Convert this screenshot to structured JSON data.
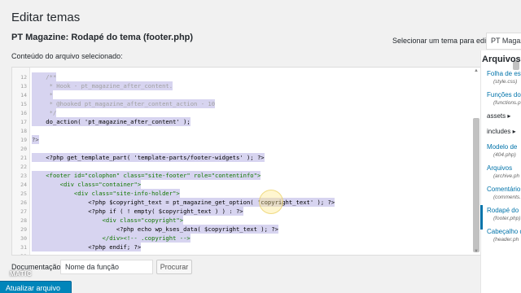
{
  "page": {
    "title": "Editar temas",
    "file_title": "PT Magazine: Rodapé do tema (footer.php)",
    "subhead": "Conteúdo do arquivo selecionado:"
  },
  "theme_selector": {
    "label": "Selecionar um tema para editar:",
    "value": "PT Magaz"
  },
  "editor": {
    "lines": [
      {
        "n": "12",
        "code": "    /**",
        "sel": true,
        "cls": "c-comment"
      },
      {
        "n": "13",
        "code": "     * Hook - pt_magazine_after_content.",
        "sel": true,
        "cls": "c-comment"
      },
      {
        "n": "14",
        "code": "     *",
        "sel": true,
        "cls": "c-comment"
      },
      {
        "n": "15",
        "code": "     * @hooked pt_magazine_after_content_action - 10",
        "sel": true,
        "cls": "c-comment"
      },
      {
        "n": "16",
        "code": "     */",
        "sel": true,
        "cls": "c-comment"
      },
      {
        "n": "17",
        "code": "    do_action( 'pt_magazine_after_content' );",
        "sel": true,
        "cls": "c-func"
      },
      {
        "n": "18",
        "code": "",
        "sel": false,
        "cls": ""
      },
      {
        "n": "19",
        "code": "?>",
        "sel": true,
        "cls": "c-php"
      },
      {
        "n": "20",
        "code": "",
        "sel": false,
        "cls": ""
      },
      {
        "n": "21",
        "code": "    <?php get_template_part( 'template-parts/footer-widgets' ); ?>",
        "sel": true,
        "cls": "c-func"
      },
      {
        "n": "22",
        "code": "",
        "sel": false,
        "cls": ""
      },
      {
        "n": "23",
        "code": "    <footer id=\"colophon\" class=\"site-footer\" role=\"contentinfo\">",
        "sel": true,
        "cls": "c-tag"
      },
      {
        "n": "24",
        "code": "        <div class=\"container\">",
        "sel": true,
        "cls": "c-tag"
      },
      {
        "n": "25",
        "code": "            <div class=\"site-info-holder\">",
        "sel": true,
        "cls": "c-tag"
      },
      {
        "n": "26",
        "code": "                <?php $copyright_text = pt_magazine_get_option( 'copyright_text' ); ?>",
        "sel": true,
        "cls": "c-func"
      },
      {
        "n": "27",
        "code": "                <?php if ( ! empty( $copyright_text ) ) : ?>",
        "sel": true,
        "cls": "c-func"
      },
      {
        "n": "28",
        "code": "                    <div class=\"copyright\">",
        "sel": true,
        "cls": "c-tag"
      },
      {
        "n": "29",
        "code": "                        <?php echo wp_kses_data( $copyright_text ); ?>",
        "sel": true,
        "cls": "c-func"
      },
      {
        "n": "30",
        "code": "                    </div><!-- .copyright -->",
        "sel": true,
        "cls": "c-tag"
      },
      {
        "n": "31",
        "code": "                <?php endif; ?>",
        "sel": true,
        "cls": "c-func"
      },
      {
        "n": "32",
        "code": "",
        "sel": false,
        "cls": ""
      }
    ]
  },
  "documentation": {
    "label": "Documentação:",
    "select_value": "Nome da função",
    "lookup_label": "Procurar"
  },
  "update_button": "Atualizar arquivo",
  "logo_text": "MATIC",
  "sidebar": {
    "title": "Arquivos d",
    "items": [
      {
        "label": "Folha de est",
        "sub": "(style.css)"
      },
      {
        "label": "Funções do",
        "sub": "(functions.p"
      },
      {
        "folder": "assets ▸"
      },
      {
        "folder": "includes ▸"
      },
      {
        "label": "Modelo de",
        "sub": "(404.php)"
      },
      {
        "label": "Arquivos",
        "sub": "(archive.ph"
      },
      {
        "label": "Comentário",
        "sub": "(comments."
      },
      {
        "label": "Rodapé do",
        "sub": "(footer.php)"
      },
      {
        "label": "Cabeçalho d",
        "sub": "(header.ph"
      }
    ]
  },
  "colors": {
    "accent": "#0085ba",
    "selection": "#d7d4f0",
    "link": "#0073aa"
  }
}
